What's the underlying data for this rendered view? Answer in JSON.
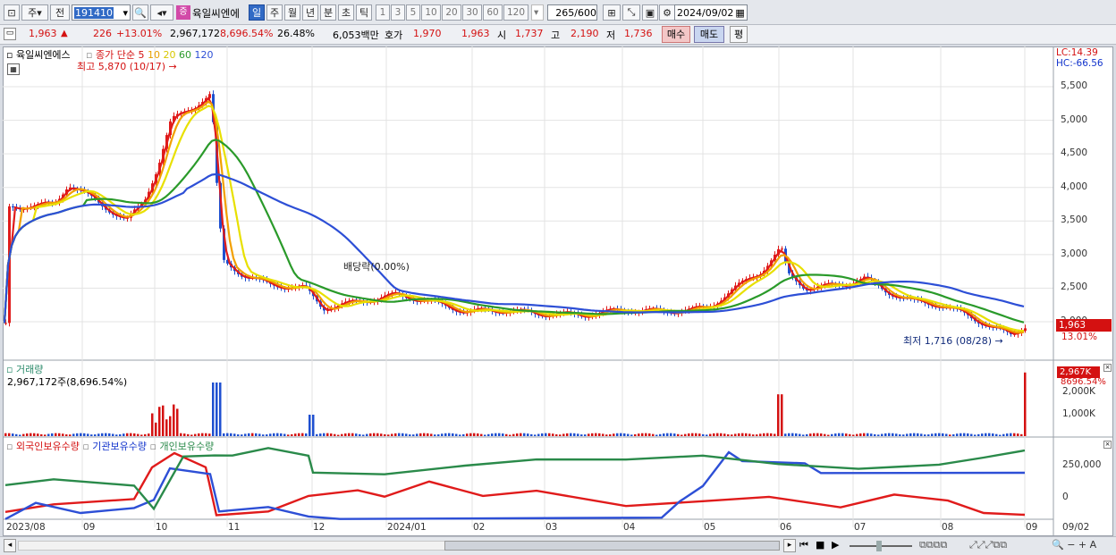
{
  "toolbar": {
    "mode": "주",
    "period_prev": "전",
    "code": "191410",
    "stock_badge": "증",
    "stock_name": "육일씨엔에",
    "timeframes": [
      "일",
      "주",
      "월",
      "년",
      "분",
      "초",
      "틱"
    ],
    "intervals": [
      "1",
      "3",
      "5",
      "10",
      "20",
      "30",
      "60",
      "120"
    ],
    "count": "265",
    "count_total": "/600",
    "date": "2024/09/02"
  },
  "quote": {
    "price": "1,963",
    "arrow": "▲",
    "change": "226",
    "change_pct": "+13.01%",
    "volume": "2,967,172",
    "volume_pct": "8,696.54%",
    "turnover": "26.48%",
    "amount": "6,053백만",
    "hoga_label": "호가",
    "ask": "1,970",
    "bid": "1,963",
    "open_label": "시",
    "open": "1,737",
    "high_label": "고",
    "high": "2,190",
    "low_label": "저",
    "low": "1,736",
    "buy_label": "매수",
    "sell_label": "매도",
    "flat_label": "평"
  },
  "price_panel": {
    "name": "육일씨엔에스",
    "legend_prefix": "종가 단순",
    "ma_periods": [
      "5",
      "10",
      "20",
      "60",
      "120"
    ],
    "ma_colors": [
      "#e01b1b",
      "#f2a000",
      "#e8e000",
      "#2a9a2a",
      "#2d4fd6"
    ],
    "high_note": "최고 5,870 (10/17)",
    "low_note": "최저 1,716 (08/28)",
    "dividend_note": "배당락(0.00%)",
    "lc": "LC:14.39",
    "hc": "HC:-66.56",
    "current_tag": "1,963",
    "current_pct": "13.01%",
    "y_ticks": [
      "5,500",
      "5,000",
      "4,500",
      "4,000",
      "3,500",
      "3,000",
      "2,500",
      "2,000"
    ]
  },
  "volume_panel": {
    "title": "거래량",
    "value": "2,967,172주(8,696.54%)",
    "tag": "2,967K",
    "tag_pct": "8696.54%",
    "y_ticks": [
      "2,000K",
      "1,000K"
    ]
  },
  "holding_panel": {
    "legend": [
      "외국인보유수량",
      "기관보유수량",
      "개인보유수량"
    ],
    "colors": [
      "#e01b1b",
      "#2d4fd6",
      "#2a8a4a"
    ],
    "y_ticks": [
      "250,000",
      "0"
    ]
  },
  "x_axis": [
    "2023/08",
    "09",
    "10",
    "11",
    "12",
    "2024/01",
    "02",
    "03",
    "04",
    "05",
    "06",
    "07",
    "08",
    "09"
  ],
  "x_axis_end": "09/02",
  "chart_data": {
    "type": "line",
    "x": [
      "2023/08",
      "09",
      "10",
      "11",
      "12",
      "2024/01",
      "02",
      "03",
      "04",
      "05",
      "06",
      "07",
      "08",
      "09/02"
    ],
    "series": [
      {
        "name": "종가",
        "values": [
          3700,
          3850,
          4100,
          2600,
          2250,
          2350,
          2150,
          2080,
          2120,
          2150,
          2950,
          2600,
          2150,
          1963
        ]
      },
      {
        "name": "120",
        "values": [
          3550,
          3680,
          3750,
          3650,
          3350,
          3000,
          2700,
          2450,
          2200,
          2250,
          2270,
          2250,
          2200,
          2150
        ]
      }
    ],
    "volume": [
      120,
      150,
      1400,
      300,
      500,
      150,
      120,
      100,
      130,
      260,
      1900,
      200,
      180,
      2967
    ],
    "ylim": [
      1700,
      5800
    ]
  }
}
